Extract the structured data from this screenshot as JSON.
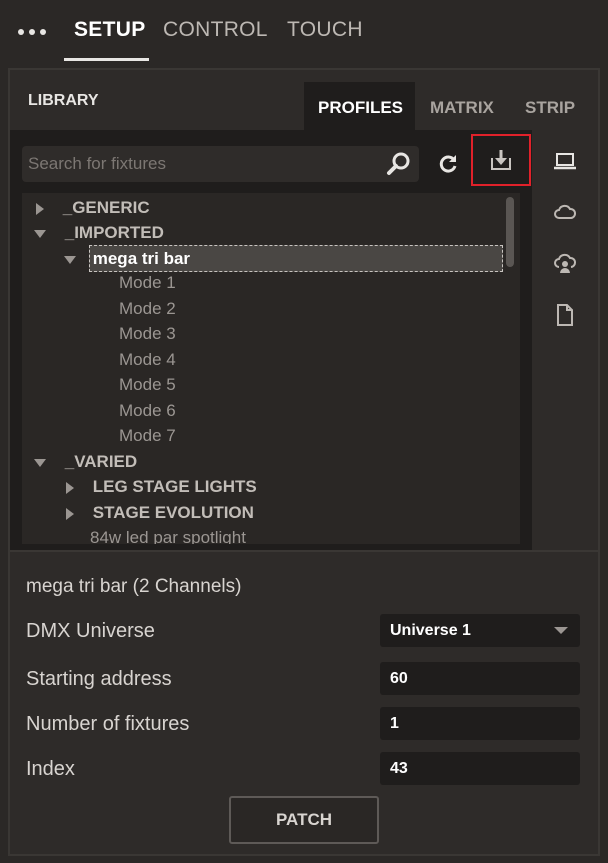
{
  "topnav": {
    "tabs": [
      {
        "label": "SETUP",
        "active": true
      },
      {
        "label": "CONTROL",
        "active": false
      },
      {
        "label": "TOUCH",
        "active": false
      }
    ]
  },
  "library": {
    "title": "LIBRARY",
    "tabs": [
      {
        "label": "PROFILES",
        "active": true
      },
      {
        "label": "MATRIX",
        "active": false
      },
      {
        "label": "STRIP",
        "active": false
      }
    ],
    "search": {
      "placeholder": "Search for fixtures",
      "value": ""
    },
    "tree": [
      {
        "label": "_GENERIC",
        "expanded": false
      },
      {
        "label": "_IMPORTED",
        "expanded": true
      },
      {
        "label": "mega tri bar",
        "expanded": true,
        "selected": true
      },
      {
        "label": "Mode 1"
      },
      {
        "label": "Mode 2"
      },
      {
        "label": "Mode 3"
      },
      {
        "label": "Mode 4"
      },
      {
        "label": "Mode 5"
      },
      {
        "label": "Mode 6"
      },
      {
        "label": "Mode 7"
      },
      {
        "label": "_VARIED",
        "expanded": true
      },
      {
        "label": "LEG STAGE LIGHTS",
        "expanded": false
      },
      {
        "label": "STAGE EVOLUTION",
        "expanded": false
      },
      {
        "label": "84w led par spotlight"
      }
    ],
    "side_icons": [
      "laptop-icon",
      "cloud-icon",
      "cloud-user-icon",
      "document-icon"
    ],
    "tool_icons": [
      "search-icon",
      "refresh-icon",
      "download-icon"
    ]
  },
  "fixture": {
    "title": "mega tri bar (2 Channels)",
    "dmx_universe_label": "DMX Universe",
    "dmx_universe_value": "Universe 1",
    "starting_address_label": "Starting address",
    "starting_address_value": "60",
    "number_of_fixtures_label": "Number of fixtures",
    "number_of_fixtures_value": "1",
    "index_label": "Index",
    "index_value": "43",
    "patch_label": "PATCH"
  },
  "colors": {
    "background": "#2b2826",
    "panel": "#2e2b29",
    "field": "#1f1d1c",
    "highlight_box": "#e0212a",
    "text": "#d8d4d0"
  }
}
